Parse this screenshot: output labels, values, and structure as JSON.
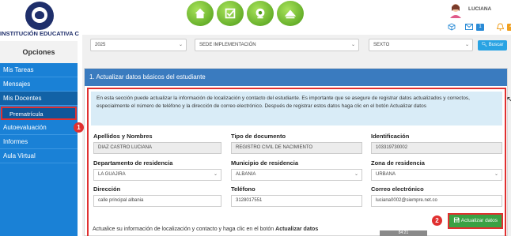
{
  "header": {
    "school_name": "INSTITUCIÓN EDUCATIVA C...",
    "user_name": "LUCIANA",
    "nav_icons": [
      "home-icon",
      "checklist-icon",
      "camera-icon",
      "hill-icon"
    ],
    "mail_count": "1",
    "notification_count": "4",
    "colors": {
      "brand": "#1f2f6b",
      "nav_green": "#5aa820"
    }
  },
  "sidebar": {
    "title": "Opciones",
    "items": [
      {
        "label": "Mis Tareas"
      },
      {
        "label": "Mensajes"
      },
      {
        "label": "Mis Docentes"
      },
      {
        "label": "Prematrícula"
      },
      {
        "label": "Autoevaluación"
      },
      {
        "label": "Informes"
      },
      {
        "label": "Aula Virtual"
      }
    ],
    "colors": {
      "background": "#1a81d6"
    }
  },
  "filters": {
    "year": "2025",
    "sede": "SEDE IMPLEMENTACIÓN",
    "grade": "SEXTO",
    "search_label": "Buscar"
  },
  "panel": {
    "title": "1. Actualizar datos básicos del estudiante",
    "info_text": "En esta sección puede actualizar la información de localización y contacto del estudiante. Es importante que se asegure de registrar datos actualizados y correctos, especialmente el número de teléfono y la dirección de correo electrónico. Después de registrar estos datos haga clic en el botón Actualizar datos",
    "fields": {
      "nombres": {
        "label": "Apellidos y Nombres",
        "value": "DIAZ CASTRO LUCIANA"
      },
      "tipo_doc": {
        "label": "Tipo de documento",
        "value": "REGISTRO CIVIL DE NACIMIENTO"
      },
      "identificacion": {
        "label": "Identificación",
        "value": "103319730002"
      },
      "departamento": {
        "label": "Departamento de residencia",
        "value": "LA GUAJIRA"
      },
      "municipio": {
        "label": "Municipio de residencia",
        "value": "ALBANIA"
      },
      "zona": {
        "label": "Zona de residencia",
        "value": "URBANA"
      },
      "direccion": {
        "label": "Dirección",
        "value": "calle principal albania"
      },
      "telefono": {
        "label": "Teléfono",
        "value": "3128017551"
      },
      "correo": {
        "label": "Correo electrónico",
        "value": "luciana0002@siempre.net.co"
      }
    },
    "footer_text": "Actualice su información de localización y contacto y haga clic en el botón",
    "footer_bold": "Actualizar datos",
    "update_button": "Actualizar datos",
    "colors": {
      "header": "#3a7bbf",
      "callout": "#e03030",
      "button": "#3aa144"
    }
  },
  "markers": {
    "one": "1",
    "two": "2"
  },
  "bottom_strip": "84:21"
}
